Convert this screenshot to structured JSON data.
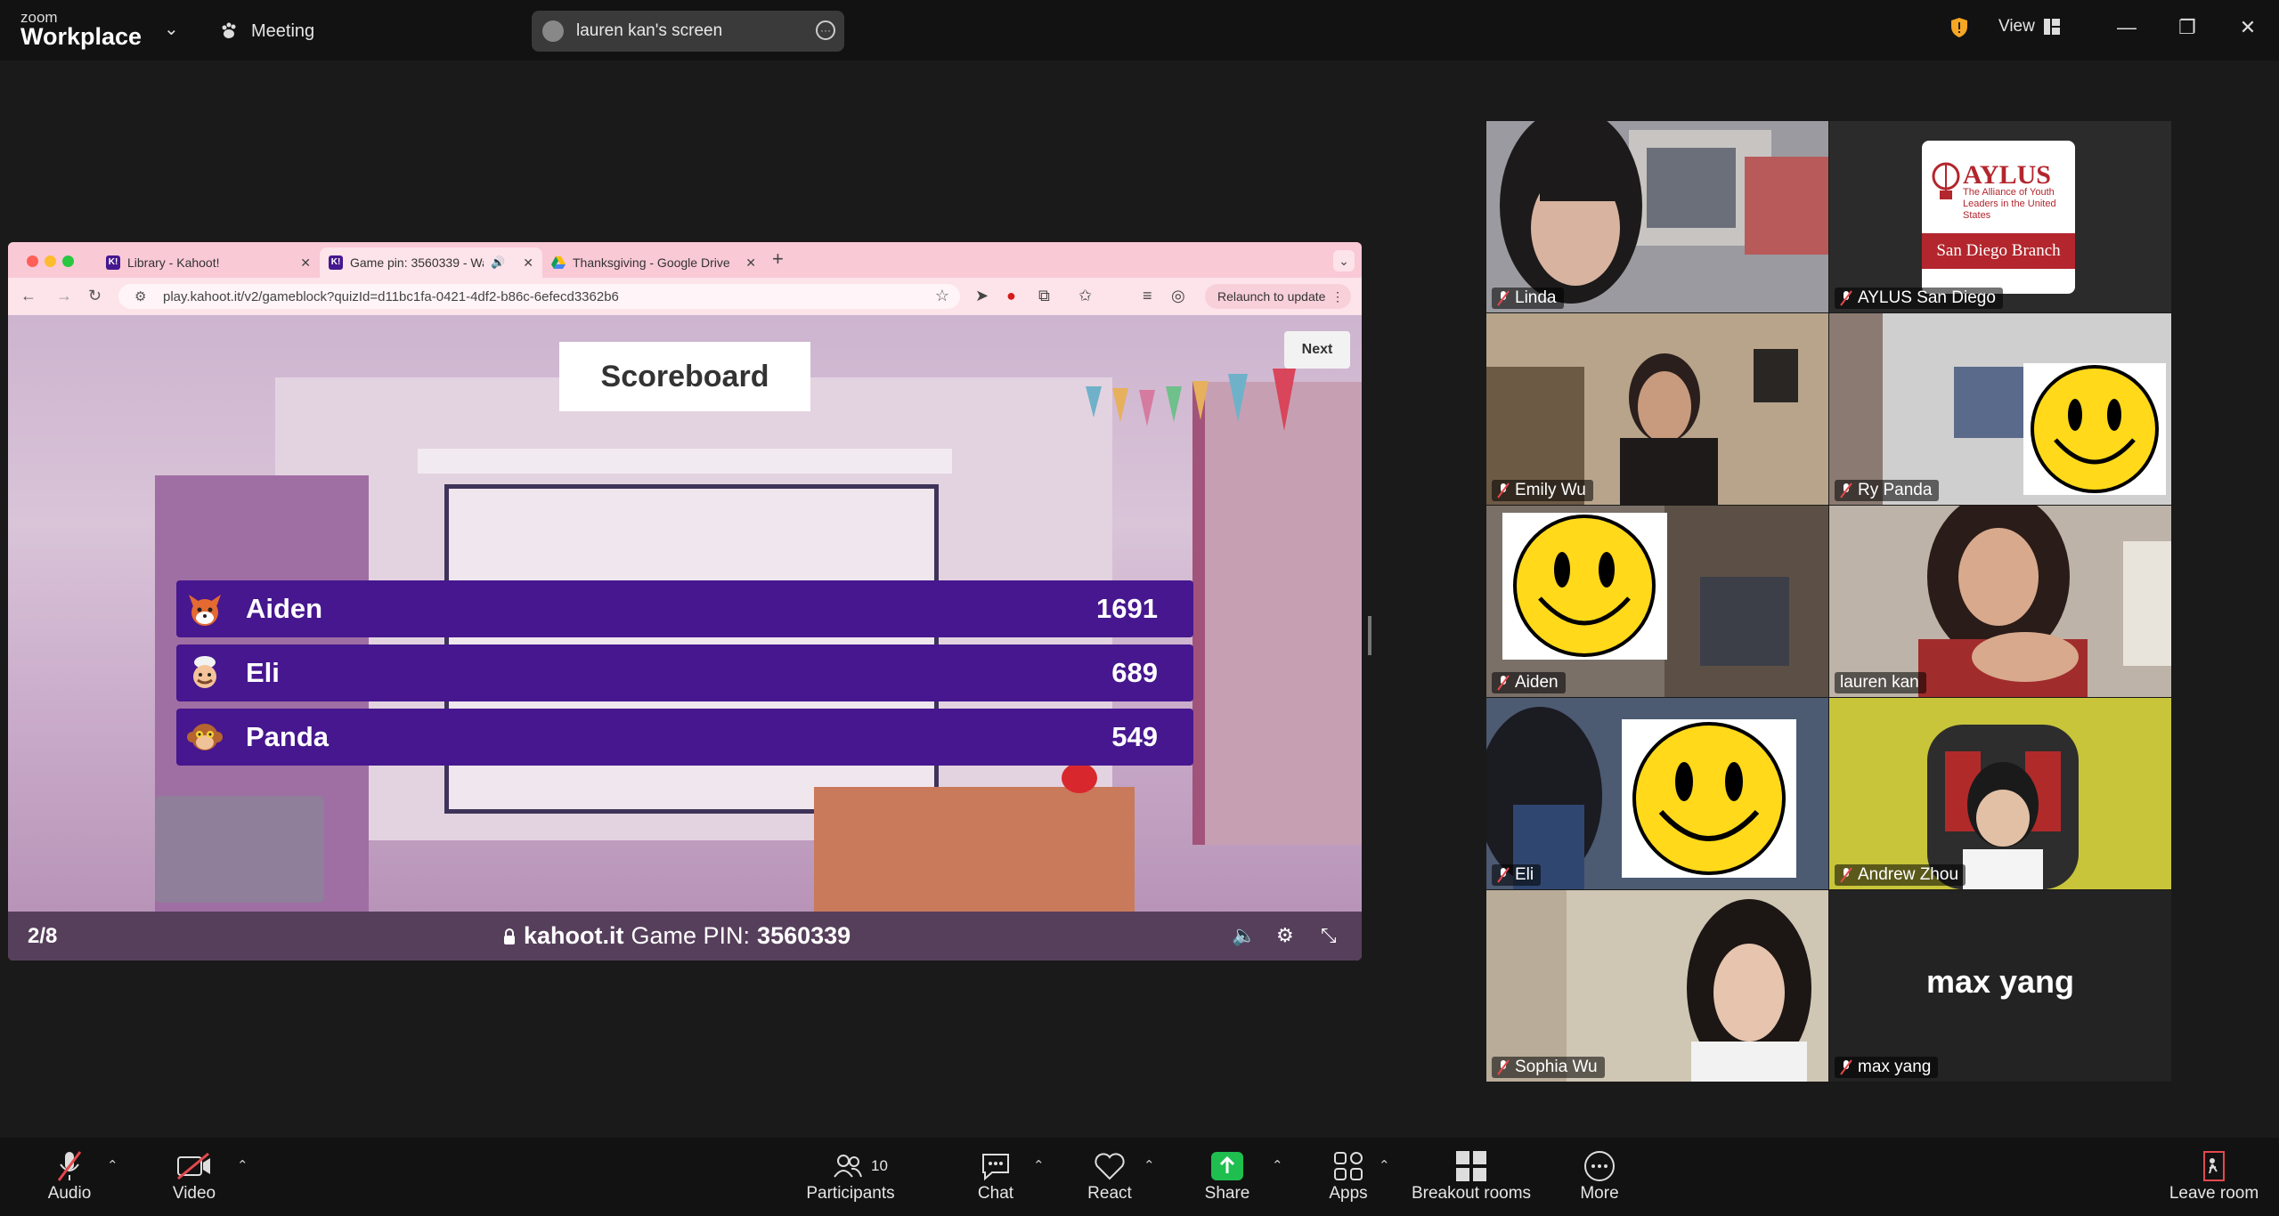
{
  "topbar": {
    "brand_small": "zoom",
    "brand_big": "Workplace",
    "meeting_label": "Meeting",
    "share_pill_text": "lauren kan's screen",
    "view_label": "View"
  },
  "browser": {
    "tabs": [
      {
        "label": "Library - Kahoot!"
      },
      {
        "label": "Game pin: 3560339 - Wa"
      },
      {
        "label": "Thanksgiving - Google Drive"
      }
    ],
    "url": "play.kahoot.it/v2/gameblock?quizId=d11bc1fa-0421-4df2-b86c-6efecd3362b6",
    "relaunch_label": "Relaunch to update"
  },
  "kahoot": {
    "title": "Scoreboard",
    "next_label": "Next",
    "players": [
      {
        "name": "Aiden",
        "score": "1691"
      },
      {
        "name": "Eli",
        "score": "689"
      },
      {
        "name": "Panda",
        "score": "549"
      }
    ],
    "footer": {
      "question_count": "2/8",
      "site": "kahoot.it",
      "pin_label": "Game PIN:",
      "pin": "3560339"
    }
  },
  "gallery": {
    "participants": [
      {
        "name": "Linda"
      },
      {
        "name": "AYLUS San Diego"
      },
      {
        "name": "Emily Wu"
      },
      {
        "name": "Ry Panda"
      },
      {
        "name": "Aiden"
      },
      {
        "name": "lauren kan"
      },
      {
        "name": "Eli"
      },
      {
        "name": "Andrew Zhou"
      },
      {
        "name": "Sophia Wu"
      },
      {
        "name": "max yang"
      }
    ],
    "aylus": {
      "name": "AYLUS",
      "tagline": "The Alliance of Youth Leaders in the United States",
      "branch": "San Diego Branch"
    },
    "max_name_display": "max yang"
  },
  "toolbar": {
    "audio": "Audio",
    "video": "Video",
    "participants": "Participants",
    "participants_count": "10",
    "chat": "Chat",
    "react": "React",
    "share": "Share",
    "apps": "Apps",
    "breakout": "Breakout rooms",
    "more": "More",
    "leave": "Leave room"
  },
  "colors": {
    "kahoot_purple": "#46178f",
    "active_speaker": "#2ed573",
    "share_green": "#1fbf4f",
    "mute_red": "#e5484d"
  }
}
